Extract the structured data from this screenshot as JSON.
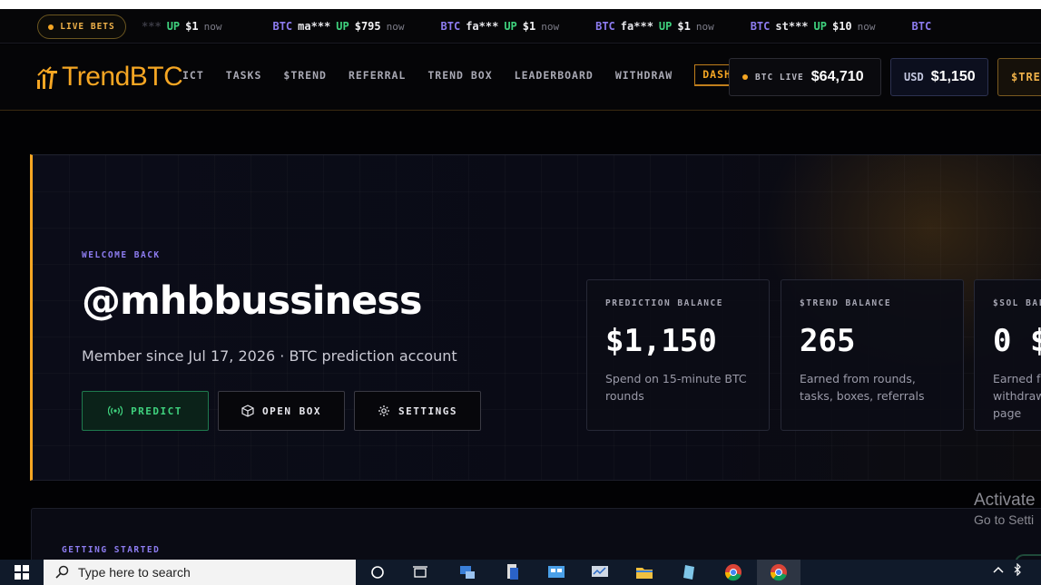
{
  "ticker": {
    "live_label": "LIVE BETS",
    "items": [
      {
        "asset": "",
        "user": "***",
        "dir": "UP",
        "amount": "$1",
        "time": "now",
        "faded": true
      },
      {
        "asset": "BTC",
        "user": "ma***",
        "dir": "UP",
        "amount": "$795",
        "time": "now"
      },
      {
        "asset": "BTC",
        "user": "fa***",
        "dir": "UP",
        "amount": "$1",
        "time": "now"
      },
      {
        "asset": "BTC",
        "user": "fa***",
        "dir": "UP",
        "amount": "$1",
        "time": "now"
      },
      {
        "asset": "BTC",
        "user": "st***",
        "dir": "UP",
        "amount": "$10",
        "time": "now"
      },
      {
        "asset": "BTC",
        "user": "",
        "dir": "",
        "amount": "",
        "time": ""
      }
    ]
  },
  "nav": {
    "logo_text": "TrendBTC",
    "links": [
      "ICT",
      "TASKS",
      "$TREND",
      "REFERRAL",
      "TREND BOX",
      "LEADERBOARD",
      "WITHDRAW",
      "DASHB"
    ],
    "btc_live_label": "BTC LIVE",
    "btc_live_value": "$64,710",
    "usd_label": "USD",
    "usd_value": "$1,150",
    "trend_label": "$TRE"
  },
  "hero": {
    "welcome": "WELCOME BACK",
    "username": "@mhbbussiness",
    "member_line": "Member since Jul 17, 2026 · BTC prediction account",
    "buttons": {
      "predict": "PREDICT",
      "open_box": "OPEN BOX",
      "settings": "SETTINGS"
    },
    "stats": [
      {
        "label": "PREDICTION BALANCE",
        "value": "$1,150",
        "desc": "Spend on 15-minute BTC rounds"
      },
      {
        "label": "$TREND BALANCE",
        "value": "265",
        "desc": "Earned from rounds, tasks, boxes, referrals"
      },
      {
        "label": "$SOL BAL",
        "value": "0 $",
        "desc": "Earned fr withdraw page"
      }
    ]
  },
  "getting_started": {
    "label": "GETTING STARTED"
  },
  "watermark": {
    "line1": "Activate",
    "line2": "Go to Setti"
  },
  "taskbar": {
    "search_placeholder": "Type here to search"
  },
  "colors": {
    "accent": "#f5a623",
    "purple": "#8d7cf0",
    "green": "#3fd27e"
  }
}
